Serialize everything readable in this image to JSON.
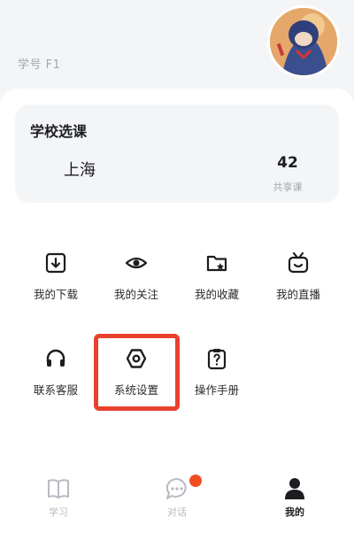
{
  "header": {
    "student_id": "学号 F1"
  },
  "school_card": {
    "title": "学校选课",
    "city": "上海",
    "shared_count": "42",
    "shared_label": "共享课"
  },
  "menu": {
    "downloads": "我的下载",
    "following": "我的关注",
    "favorites": "我的收藏",
    "live": "我的直播",
    "support": "联系客服",
    "settings": "系统设置",
    "manual": "操作手册"
  },
  "tabbar": {
    "study": "学习",
    "chat": "对话",
    "mine": "我的"
  },
  "colors": {
    "highlight": "#e8422f",
    "badge": "#f14d22",
    "active_tab": "#1c1d20",
    "inactive_tab": "#b7bac1"
  },
  "icons": [
    "download-icon",
    "eye-icon",
    "favorites-folder-icon",
    "tv-icon",
    "headset-icon",
    "hexagon-settings-icon",
    "clipboard-question-icon",
    "book-icon",
    "chat-bubble-icon",
    "person-icon"
  ]
}
